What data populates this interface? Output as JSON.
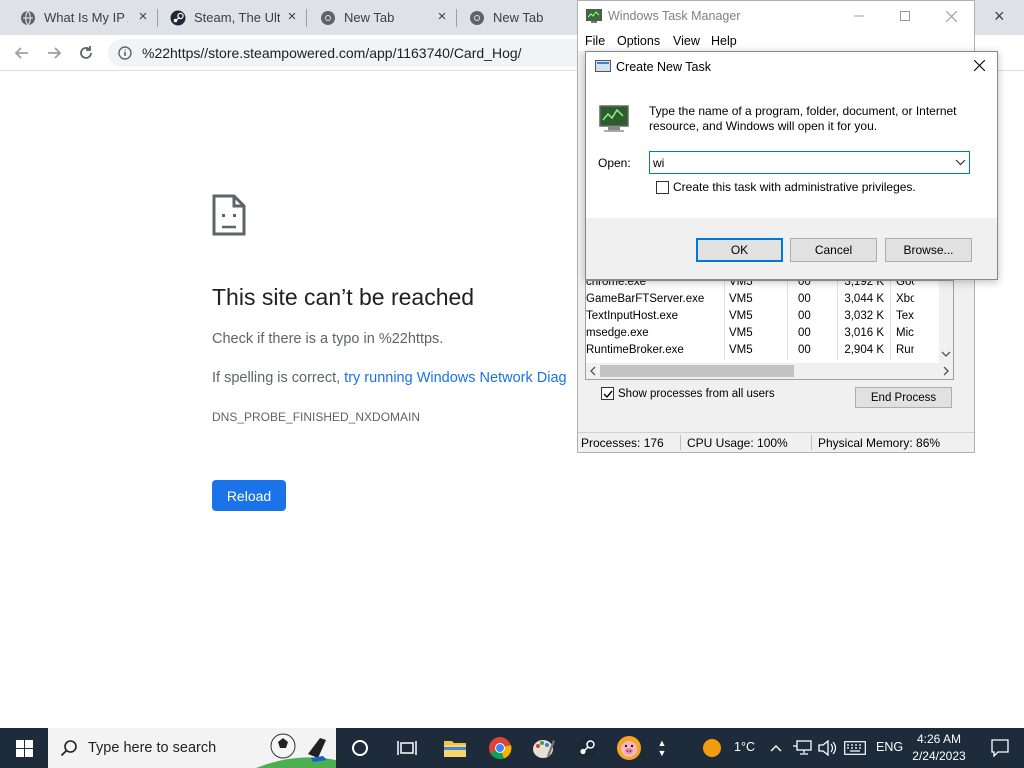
{
  "browser": {
    "tabs": [
      {
        "title": "What Is My IP A",
        "icon": "globe-icon",
        "active": false
      },
      {
        "title": "Steam, The Ultim",
        "icon": "steam-icon",
        "active": false
      },
      {
        "title": "New Tab",
        "icon": "chrome-icon",
        "active": false
      },
      {
        "title": "New Tab",
        "icon": "chrome-icon",
        "active": true
      }
    ],
    "close_glyph": "×",
    "url": "%22https//store.steampowered.com/app/1163740/Card_Hog/"
  },
  "error_page": {
    "title": "This site can’t be reached",
    "line1": "Check if there is a typo in %22https.",
    "line2_prefix": "If spelling is correct, ",
    "line2_link": "try running Windows Network Diag",
    "code": "DNS_PROBE_FINISHED_NXDOMAIN",
    "reload_label": "Reload"
  },
  "task_manager": {
    "title": "Windows Task Manager",
    "menu": [
      "File",
      "Options",
      "View",
      "Help"
    ],
    "processes": [
      {
        "name": "chrome.exe",
        "user": "VM5",
        "cpu": "00",
        "mem": "3,192 K",
        "desc": "Goo"
      },
      {
        "name": "GameBarFTServer.exe",
        "user": "VM5",
        "cpu": "00",
        "mem": "3,044 K",
        "desc": "Xbo"
      },
      {
        "name": "TextInputHost.exe",
        "user": "VM5",
        "cpu": "00",
        "mem": "3,032 K",
        "desc": "Tex"
      },
      {
        "name": "msedge.exe",
        "user": "VM5",
        "cpu": "00",
        "mem": "3,016 K",
        "desc": "Mic"
      },
      {
        "name": "RuntimeBroker.exe",
        "user": "VM5",
        "cpu": "00",
        "mem": "2,904 K",
        "desc": "Run"
      }
    ],
    "show_all_label": "Show processes from all users",
    "show_all_checked": true,
    "end_process_label": "End Process",
    "status": {
      "processes": "Processes: 176",
      "cpu": "CPU Usage: 100%",
      "memory": "Physical Memory: 86%"
    }
  },
  "create_task_dialog": {
    "title": "Create New Task",
    "description": "Type the name of a program, folder, document, or Internet resource, and Windows will open it for you.",
    "open_label": "Open:",
    "open_value": "wi",
    "admin_label": "Create this task with administrative privileges.",
    "admin_checked": false,
    "ok_label": "OK",
    "cancel_label": "Cancel",
    "browse_label": "Browse..."
  },
  "taskbar": {
    "search_placeholder": "Type here to search",
    "weather": "1°C",
    "language": "ENG",
    "time": "4:26 AM",
    "date": "2/24/2023",
    "accent": "#1d2b3a"
  }
}
